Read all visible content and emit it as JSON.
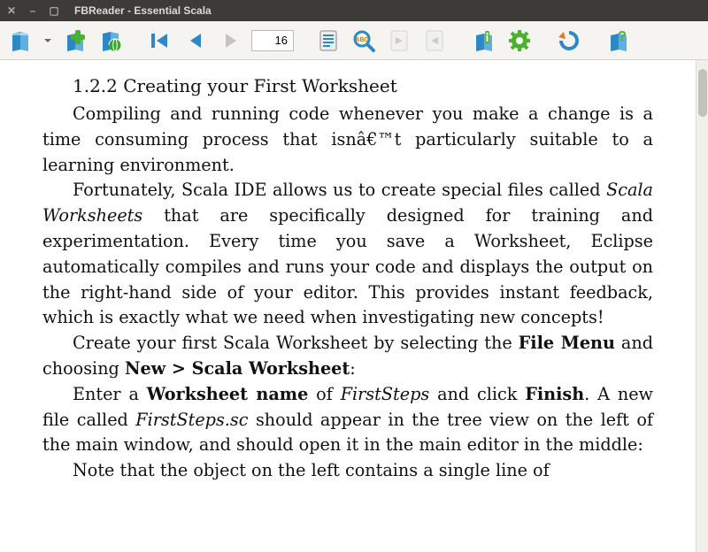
{
  "window": {
    "title": "FBReader - Essential Scala"
  },
  "toolbar": {
    "page_number": "16"
  },
  "doc": {
    "heading": "1.2.2 Creating your First Worksheet",
    "p1": "Compiling and running code whenever you make a change is a time consuming process that isnâ€™t particularly suitable to a learning environment.",
    "p2a": "Fortunately, Scala IDE allows us to create special files called ",
    "p2_i1": "Scala Worksheets",
    "p2b": " that are specifically designed for training and experimentation. Every time you save a Worksheet, Eclipse automatically compiles and runs your code and displays the output on the right-hand side of your editor. This provides instant feedback, which is exactly what we need when investigating new concepts!",
    "p3a": "Create your first Scala Worksheet by selecting the ",
    "p3_b1": "File Menu",
    "p3b": " and choosing ",
    "p3_b2": "New > Scala Worksheet",
    "p3c": ":",
    "p4a": "Enter a ",
    "p4_b1": "Worksheet name",
    "p4b": " of ",
    "p4_i1": "FirstSteps",
    "p4c": " and click ",
    "p4_b2": "Finish",
    "p4d": ". A new file called ",
    "p4_i2": "FirstSteps.sc",
    "p4e": " should appear in the tree view on the left of the main window, and should open it in the main editor in the middle:",
    "p5": "Note that the object on the left contains a single line of"
  }
}
